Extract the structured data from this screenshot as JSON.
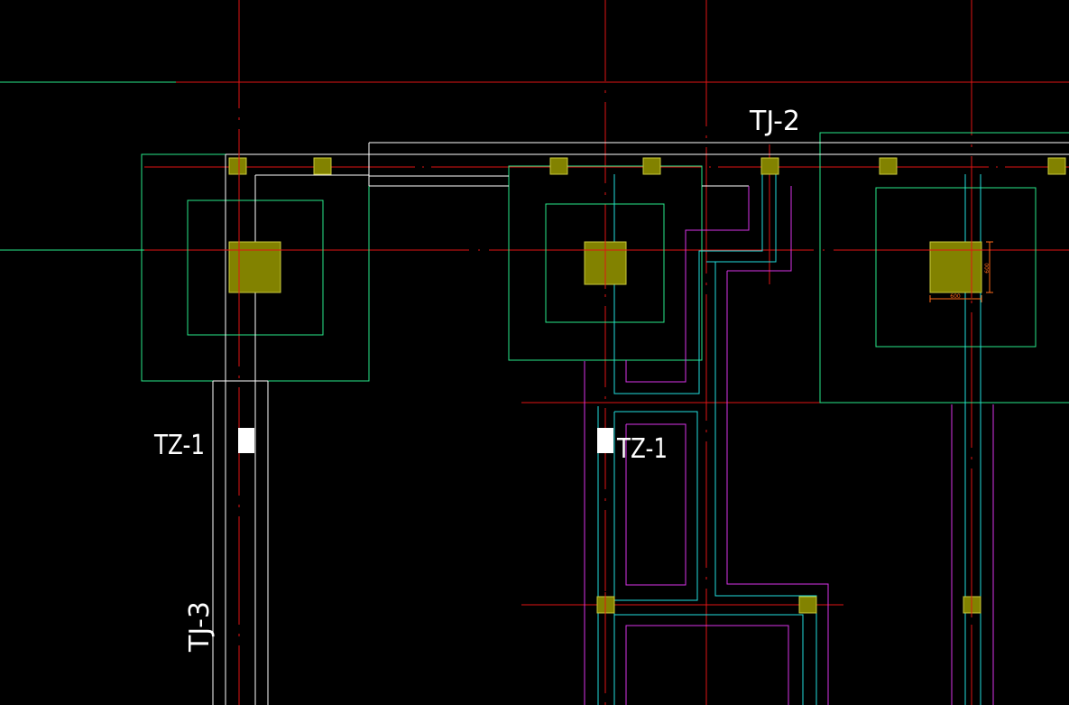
{
  "labels": {
    "tj2": "TJ-2",
    "tz1_left": "TZ-1",
    "tz1_right": "TZ-1",
    "tj3": "TJ-3",
    "dim_width": "600",
    "dim_height": "600"
  },
  "colors": {
    "background": "#000000",
    "axis_line": "#e01515",
    "footing_outline": "#29e88a",
    "beam_outline": "#ffffff",
    "pipe_cyan": "#22dede",
    "pipe_magenta": "#d833e8",
    "column_fill": "#828200",
    "column_stroke": "#c9c93b",
    "text": "#ffffff",
    "dimension": "#ff6a1a"
  }
}
